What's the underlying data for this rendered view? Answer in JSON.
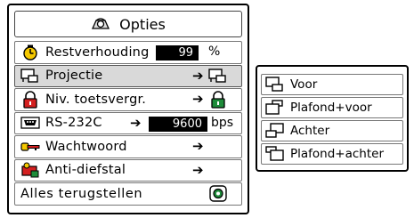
{
  "menu": {
    "title": "Opties",
    "title_icon": "options-icon",
    "items": [
      {
        "label": "Restverhouding",
        "icon": "timer-icon",
        "value": "99",
        "unit": "%"
      },
      {
        "label": "Projectie",
        "icon": "projection-icon",
        "selected": true
      },
      {
        "label": "Niv. toetsvergr.",
        "icon": "lock-icon"
      },
      {
        "label": "RS-232C",
        "icon": "rs232c-port-icon",
        "value": "9600",
        "unit": "bps"
      },
      {
        "label": "Wachtwoord",
        "icon": "key-icon"
      },
      {
        "label": "Anti-diefstal",
        "icon": "anti-theft-icon"
      },
      {
        "label": "Alles terugstellen",
        "icon": "reset-icon"
      }
    ]
  },
  "submenu": {
    "items": [
      {
        "label": "Voor",
        "icon": "front-projection-icon"
      },
      {
        "label": "Plafond+voor",
        "icon": "ceiling-front-projection-icon"
      },
      {
        "label": "Achter",
        "icon": "rear-projection-icon"
      },
      {
        "label": "Plafond+achter",
        "icon": "ceiling-rear-projection-icon"
      }
    ]
  },
  "colors": {
    "selected_row": "#d9d9d9",
    "value_box": "#000000",
    "accent_red": "#d42020",
    "accent_yellow": "#f5c800",
    "accent_green": "#1e8c3a"
  }
}
